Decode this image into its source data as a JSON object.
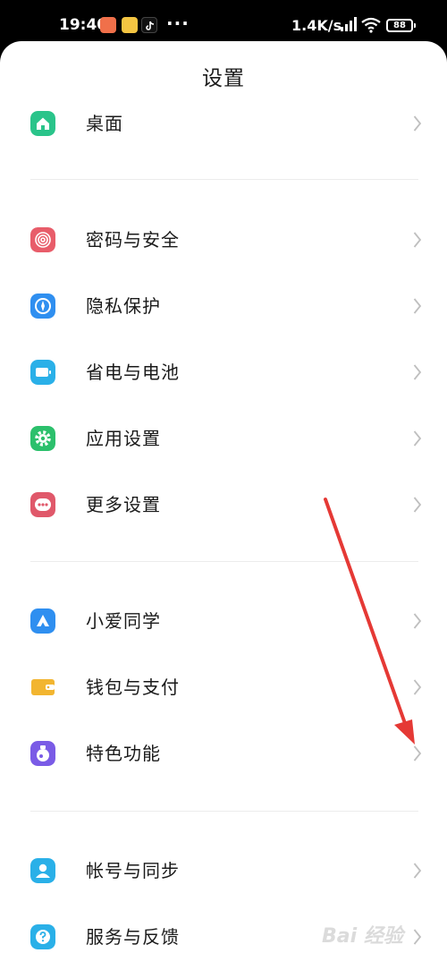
{
  "status_bar": {
    "time": "19:40",
    "dots": "···",
    "network_speed": "1.4K/s",
    "battery": "88"
  },
  "page": {
    "title": "设置"
  },
  "colors": {
    "accent_arrow": "#e53935",
    "chevron": "#bfbfbf",
    "divider": "#ececec"
  },
  "groups": [
    {
      "items": [
        {
          "label": "桌面",
          "icon": "home-icon",
          "color": "#2ac48a"
        }
      ]
    },
    {
      "items": [
        {
          "label": "密码与安全",
          "icon": "fingerprint-icon",
          "color": "#e85d6a"
        },
        {
          "label": "隐私保护",
          "icon": "privacy-shield-icon",
          "color": "#2f8ff0"
        },
        {
          "label": "省电与电池",
          "icon": "battery-icon",
          "color": "#2ab0e8"
        },
        {
          "label": "应用设置",
          "icon": "gear-icon",
          "color": "#2cc06c"
        },
        {
          "label": "更多设置",
          "icon": "more-dots-icon",
          "color": "#e0586a"
        }
      ]
    },
    {
      "items": [
        {
          "label": "小爱同学",
          "icon": "xiaoai-icon",
          "color": "#2f8ff0"
        },
        {
          "label": "钱包与支付",
          "icon": "wallet-icon",
          "color": "#f2b530"
        },
        {
          "label": "特色功能",
          "icon": "flask-icon",
          "color": "#7a5be6"
        }
      ]
    },
    {
      "items": [
        {
          "label": "帐号与同步",
          "icon": "account-icon",
          "color": "#2ab0e8"
        },
        {
          "label": "服务与反馈",
          "icon": "help-icon",
          "color": "#2ab0e8"
        }
      ]
    }
  ],
  "watermark": "Bai 经验"
}
